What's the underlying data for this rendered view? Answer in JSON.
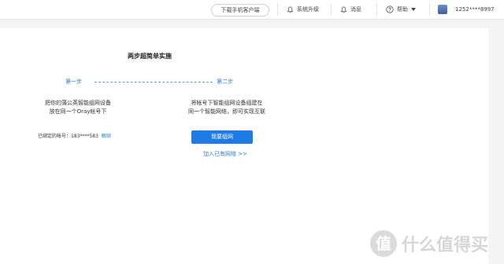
{
  "header": {
    "download_label": "下载手机客户端",
    "upgrade_label": "系统升级",
    "messages_label": "消息",
    "help_label": "帮助",
    "account_label": "1252****8997"
  },
  "main": {
    "title": "两步超简单实施",
    "step1": {
      "label": "第一步",
      "desc_line1": "把你的蒲公英智能组网设备",
      "desc_line2": "放在同一个Oray帐号下",
      "bound_label": "已绑定的帐号：183****583",
      "unbind_label": "解绑"
    },
    "step2": {
      "label": "第二步",
      "desc_line1": "将帐号下智能组网设备组建在",
      "desc_line2": "同一个智能网络，即可实现互联",
      "primary_button": "我要组网",
      "join_link": "加入已有网络 >>"
    }
  },
  "watermark": {
    "badge": "值",
    "text": "什么值得买"
  },
  "colors": {
    "accent": "#1e7be6",
    "link": "#2e7fd1"
  }
}
